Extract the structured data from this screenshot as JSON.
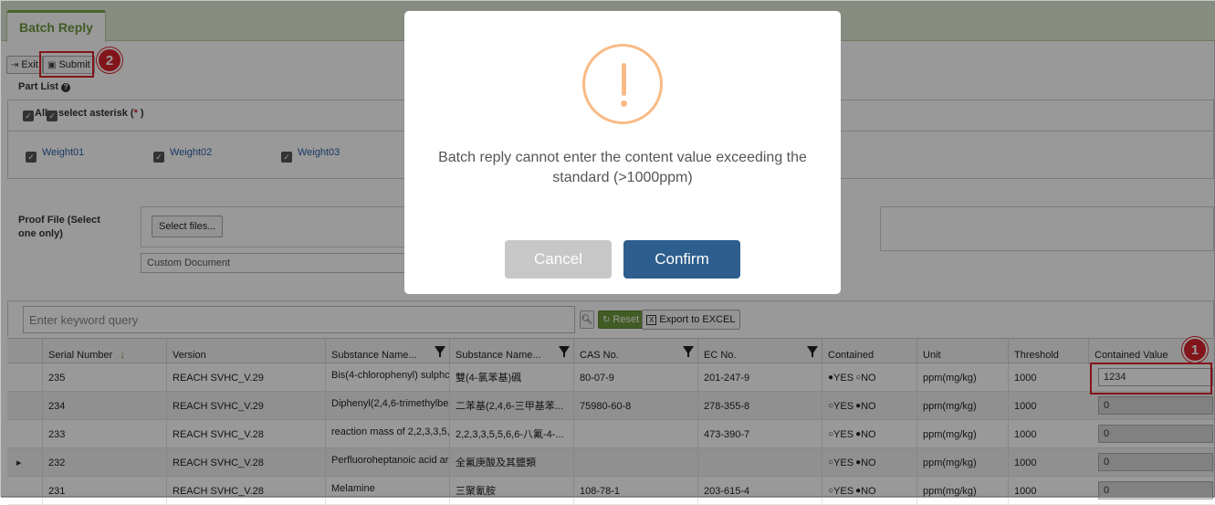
{
  "tab": {
    "label": "Batch Reply"
  },
  "toolbar": {
    "exit_label": "Exit",
    "submit_label": "Submit"
  },
  "annotations": {
    "badge1": "1",
    "badge2": "2"
  },
  "part_list": {
    "title": "Part List",
    "all_label": "All",
    "select_asterisk_label": "select asterisk (",
    "asterisk": "*",
    "close_paren": " )",
    "weights": [
      "Weight01",
      "Weight02",
      "Weight03"
    ]
  },
  "proof_file": {
    "label": "Proof File (Select one only)",
    "select_button": "Select files...",
    "doc_type": "Custom Document"
  },
  "search": {
    "placeholder": "Enter keyword query",
    "reset_label": "Reset",
    "export_label": "Export to EXCEL"
  },
  "columns": [
    "Serial Number",
    "Version",
    "Substance Name...",
    "Substance Name...",
    "CAS No.",
    "EC No.",
    "Contained",
    "Unit",
    "Threshold",
    "Contained Value"
  ],
  "rows": [
    {
      "serial": "235",
      "version": "REACH SVHC_V.29",
      "name_en": "Bis(4-chlorophenyl) sulphc",
      "name_zh": "雙(4-氯苯基)碸",
      "cas": "80-07-9",
      "ec": "201-247-9",
      "yes": "YES",
      "no": "NO",
      "contained": "yes",
      "unit": "ppm(mg/kg)",
      "threshold": "1000",
      "value": "1234",
      "marker": ""
    },
    {
      "serial": "234",
      "version": "REACH SVHC_V.29",
      "name_en": "Diphenyl(2,4,6-trimethylbe",
      "name_zh": "二苯基(2,4,6-三甲基苯...",
      "cas": "75980-60-8",
      "ec": "278-355-8",
      "yes": "YES",
      "no": "NO",
      "contained": "no",
      "unit": "ppm(mg/kg)",
      "threshold": "1000",
      "value": "0",
      "marker": ""
    },
    {
      "serial": "233",
      "version": "REACH SVHC_V.28",
      "name_en": "reaction mass of 2,2,3,3,5,",
      "name_zh": "2,2,3,3,5,5,6,6-八氟-4-...",
      "cas": "",
      "ec": "473-390-7",
      "yes": "YES",
      "no": "NO",
      "contained": "no",
      "unit": "ppm(mg/kg)",
      "threshold": "1000",
      "value": "0",
      "marker": ""
    },
    {
      "serial": "232",
      "version": "REACH SVHC_V.28",
      "name_en": "Perfluoroheptanoic acid ar",
      "name_zh": "全氟庚酸及其鹽類",
      "cas": "",
      "ec": "",
      "yes": "YES",
      "no": "NO",
      "contained": "no",
      "unit": "ppm(mg/kg)",
      "threshold": "1000",
      "value": "0",
      "marker": "▸"
    },
    {
      "serial": "231",
      "version": "REACH SVHC_V.28",
      "name_en": "Melamine",
      "name_zh": "三聚氰胺",
      "cas": "108-78-1",
      "ec": "203-615-4",
      "yes": "YES",
      "no": "NO",
      "contained": "no",
      "unit": "ppm(mg/kg)",
      "threshold": "1000",
      "value": "0",
      "marker": ""
    }
  ],
  "dialog": {
    "message": "Batch reply cannot enter the content value exceeding the standard (>1000ppm)",
    "cancel_label": "Cancel",
    "confirm_label": "Confirm"
  },
  "colors": {
    "accent": "#7da34f",
    "confirm": "#2d5e8d",
    "cancel": "#c7c7c7",
    "warning": "#f8bb86",
    "highlight": "#d9232c"
  }
}
